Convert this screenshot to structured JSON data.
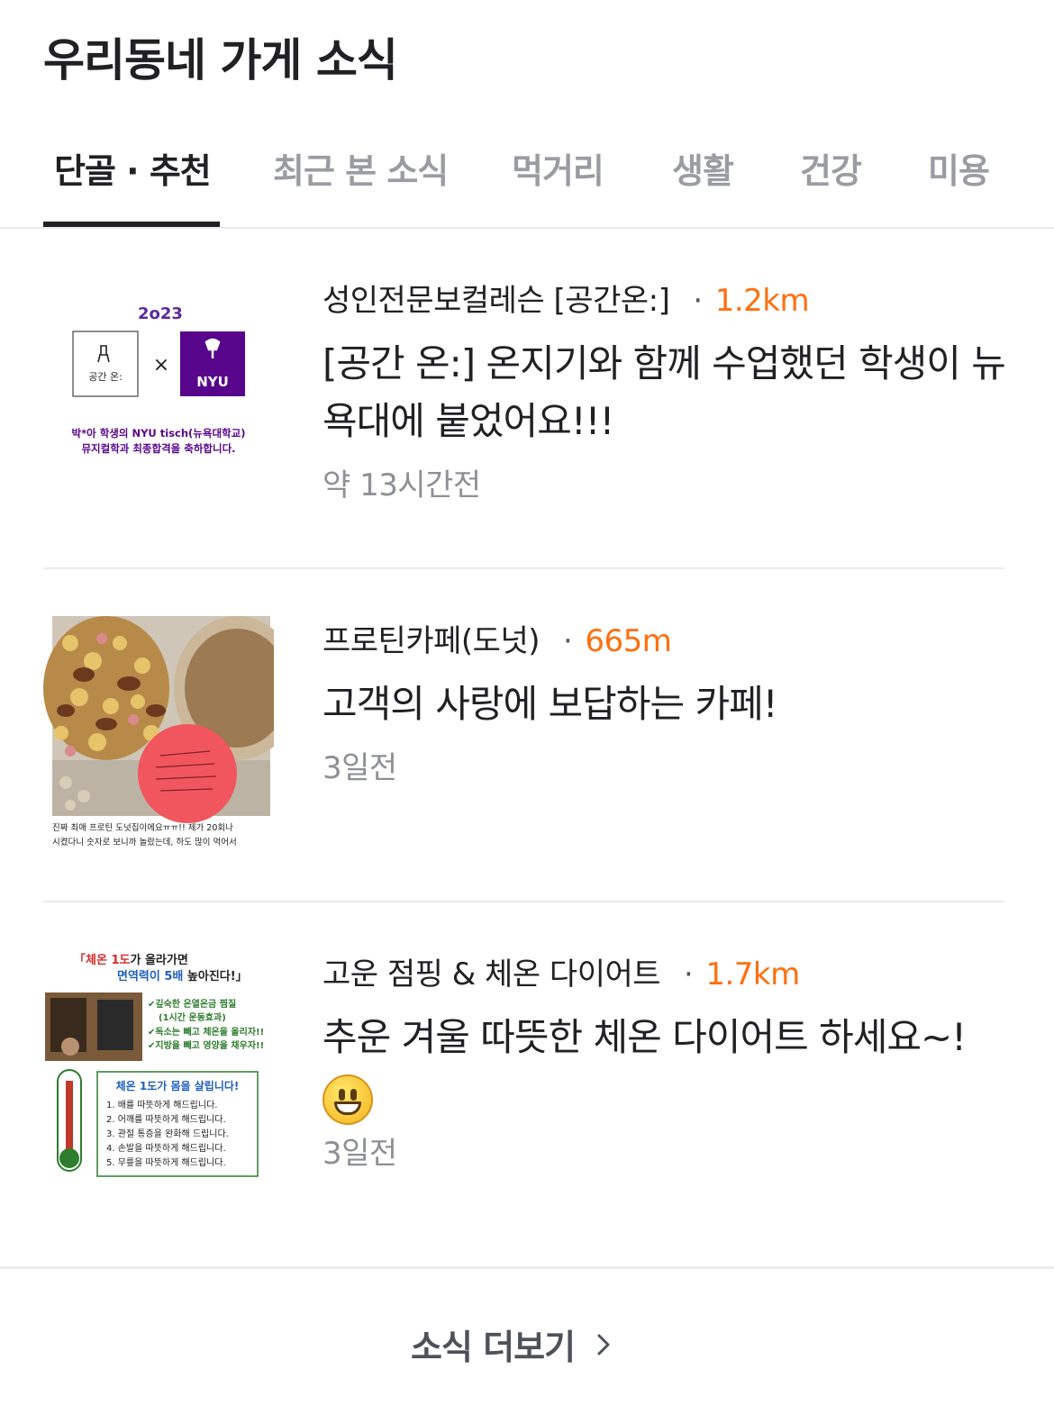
{
  "header": {
    "title": "우리동네 가게 소식"
  },
  "tabs": [
    {
      "label": "단골 · 추천",
      "active": true
    },
    {
      "label": "최근 본 소식",
      "active": false
    },
    {
      "label": "먹거리",
      "active": false
    },
    {
      "label": "생활",
      "active": false
    },
    {
      "label": "건강",
      "active": false
    },
    {
      "label": "미용",
      "active": false
    }
  ],
  "articles": [
    {
      "store": "성인전문보컬레슨 [공간온:]",
      "distance": "1.2km",
      "title": "[공간 온:] 온지기와 함께 수업했던 학생이 뉴욕대에 붙었어요!!!",
      "time": "약 13시간전",
      "thumb": {
        "year": "2o23",
        "left_logo": "공간 온:",
        "right_logo": "NYU",
        "caption_1": "박*아 학생의 NYU tisch(뉴욕대학교)",
        "caption_2": "뮤지컬학과 최종합격을 축하합니다."
      }
    },
    {
      "store": "프로틴카페(도넛)",
      "distance": "665m",
      "title": "고객의 사랑에 보답하는 카페!",
      "time": "3일전",
      "thumb": {
        "caption_1": "진짜 최애 프로틴 도넛집이에요ㅠㅠ!! 제가 20회나",
        "caption_2": "시켰다니 숫자로 보니까 놀랐는데, 하도 많이 먹어서"
      }
    },
    {
      "store": "고운 점핑 & 체온 다이어트",
      "distance": "1.7km",
      "title": "추운 겨울 따뜻한 체온 다이어트 하세요~!",
      "time": "3일전",
      "thumb": {
        "headline_1a": "「체온 1도",
        "headline_1b": "가 올라가면",
        "headline_2a": "면역력이 5배",
        "headline_2b": " 높아진다!」",
        "check_1": "✔깊숙한 온열온금 찜질",
        "check_2": "(1시간 운동효과)",
        "check_3": "✔독소는 빼고 체온을 올리자!!",
        "check_4": "✔지방을 빼고 영양을 채우자!!",
        "box_title": "체온 1도가 몸을 살립니다!",
        "list": [
          "1. 배를 따뜻하게 해드립니다.",
          "2. 어깨를 따뜻하게 해드립니다.",
          "3. 관절 통증을 완화해 드립니다.",
          "4. 손발을 따뜻하게 해드립니다.",
          "5. 무릎을 따뜻하게 해드립니다."
        ]
      }
    }
  ],
  "more": {
    "label": "소식 더보기"
  },
  "colors": {
    "distance": "#ff6f0f",
    "nyu_purple": "#57068c",
    "active_tab": "#212124",
    "inactive_tab": "#9a9ca2"
  }
}
